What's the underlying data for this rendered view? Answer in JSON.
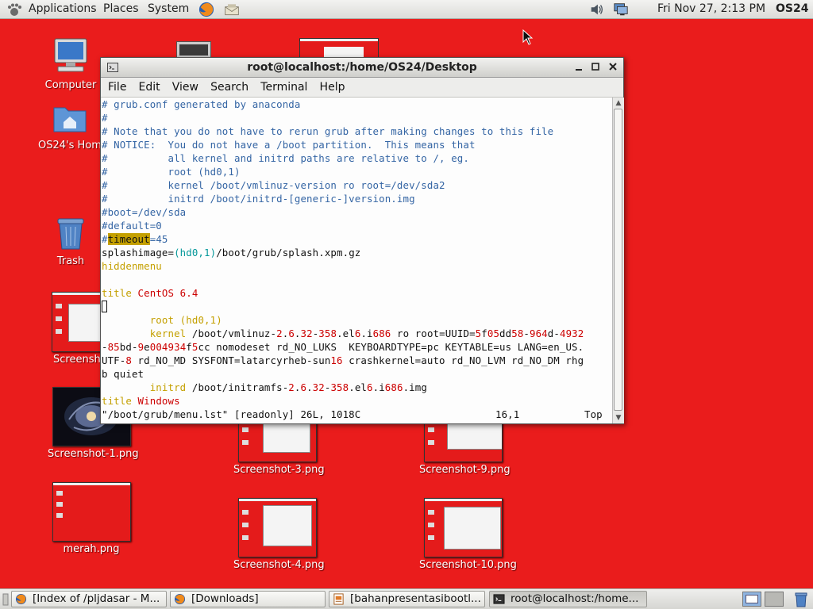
{
  "top_panel": {
    "menus": [
      "Applications",
      "Places",
      "System"
    ],
    "clock": "Fri Nov 27,  2:13 PM",
    "user": "OS24"
  },
  "desktop": {
    "icons": [
      {
        "label": "Computer"
      },
      {
        "label": "OS24's Hom"
      },
      {
        "label": "Trash"
      },
      {
        "label": "Screensh"
      },
      {
        "label": "Screenshot-1.png"
      },
      {
        "label": "merah.png"
      },
      {
        "label": "Screenshot-3.png"
      },
      {
        "label": "Screenshot-9.png"
      },
      {
        "label": "Screenshot-4.png"
      },
      {
        "label": "Screenshot-10.png"
      }
    ]
  },
  "terminal": {
    "title": "root@localhost:/home/OS24/Desktop",
    "menu": [
      "File",
      "Edit",
      "View",
      "Search",
      "Terminal",
      "Help"
    ],
    "lines": [
      "# grub.conf generated by anaconda",
      "#",
      "# Note that you do not have to rerun grub after making changes to this file",
      "# NOTICE:  You do not have a /boot partition.  This means that",
      "#          all kernel and initrd paths are relative to /, eg.",
      "#          root (hd0,1)",
      "#          kernel /boot/vmlinuz-version ro root=/dev/sda2",
      "#          initrd /boot/initrd-[generic-]version.img",
      "#boot=/dev/sda",
      "#default=0",
      "#timeout=45",
      "splashimage=(hd0,1)/boot/grub/splash.xpm.gz",
      "hiddenmenu",
      "",
      "title CentOS 6.4",
      "",
      "        root (hd0,1)",
      "        kernel /boot/vmlinuz-2.6.32-358.el6.i686 ro root=UUID=5f05dd58-964d-4932",
      "-85bd-9e004934f5cc nomodeset rd_NO_LUKS  KEYBOARDTYPE=pc KEYTABLE=us LANG=en_US.",
      "UTF-8 rd_NO_MD SYSFONT=latarcyrheb-sun16 crashkernel=auto rd_NO_LVM rd_NO_DM rhg",
      "b quiet",
      "        initrd /boot/initramfs-2.6.32-358.el6.i686.img",
      "title Windows"
    ],
    "status": {
      "file": "\"/boot/grub/menu.lst\" [readonly] 26L, 1018C",
      "position": "16,1",
      "scroll": "Top"
    }
  },
  "taskbar": {
    "tasks": [
      {
        "label": "[Index of /pljdasar - M..."
      },
      {
        "label": "[Downloads]"
      },
      {
        "label": "[bahanpresentasibootl..."
      },
      {
        "label": "root@localhost:/home..."
      }
    ]
  },
  "colors": {
    "desktop": "#ea1c1c",
    "comment": "#3465a4",
    "keyword": "#c4a000",
    "number": "#cc0000",
    "paren": "#06989a"
  }
}
